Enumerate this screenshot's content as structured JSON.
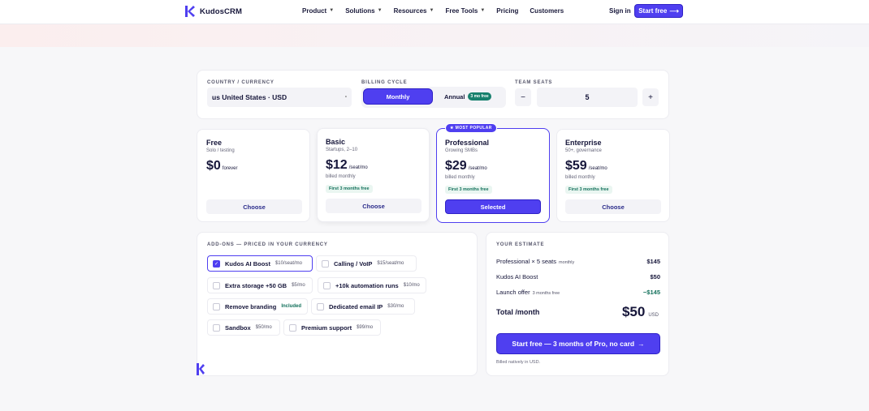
{
  "nav": {
    "brand": "KudosCRM",
    "links": [
      {
        "label": "Product",
        "dropdown": true
      },
      {
        "label": "Solutions",
        "dropdown": true
      },
      {
        "label": "Resources",
        "dropdown": true
      },
      {
        "label": "Free Tools",
        "dropdown": true
      },
      {
        "label": "Pricing",
        "dropdown": false
      },
      {
        "label": "Customers",
        "dropdown": false
      }
    ],
    "sign_in": "Sign in",
    "start_free": "Start free",
    "start_free_arrow": "⟶"
  },
  "config": {
    "country_label": "COUNTRY / CURRENCY",
    "country_value": "us United States · USD",
    "billing_label": "BILLING CYCLE",
    "billing_monthly": "Monthly",
    "billing_annual": "Annual",
    "billing_annual_badge": "3 mo free",
    "seats_label": "TEAM SEATS",
    "seats_value": "5",
    "seats_minus": "−",
    "seats_plus": "+"
  },
  "plans": [
    {
      "name": "Free",
      "sub": "Solo / testing",
      "price": "$0",
      "unit": "forever",
      "billed": "",
      "promo": "",
      "button": "Choose",
      "selected": false
    },
    {
      "name": "Basic",
      "sub": "Startups, 2–10",
      "price": "$12",
      "unit": "/seat/mo",
      "billed": "billed monthly",
      "promo": "First 3 months free",
      "button": "Choose",
      "selected": false
    },
    {
      "name": "Professional",
      "sub": "Growing SMBs",
      "price": "$29",
      "unit": "/seat/mo",
      "billed": "billed monthly",
      "promo": "First 3 months free",
      "button": "Selected",
      "selected": true,
      "badge": "★ MOST POPULAR"
    },
    {
      "name": "Enterprise",
      "sub": "50+, governance",
      "price": "$59",
      "unit": "/seat/mo",
      "billed": "billed monthly",
      "promo": "First 3 months free",
      "button": "Choose",
      "selected": false
    }
  ],
  "addons": {
    "title": "ADD-ONS — PRICED IN YOUR CURRENCY",
    "items": [
      {
        "name": "Kudos AI Boost",
        "price": "$10/seat/mo",
        "checked": true
      },
      {
        "name": "Calling / VoIP",
        "price": "$15/seat/mo",
        "checked": false
      },
      {
        "name": "Extra storage +50 GB",
        "price": "$5/mo",
        "checked": false
      },
      {
        "name": "+10k automation runs",
        "price": "$10/mo",
        "checked": false
      },
      {
        "name": "Remove branding",
        "price": "Included",
        "checked": false
      },
      {
        "name": "Dedicated email IP",
        "price": "$30/mo",
        "checked": false
      },
      {
        "name": "Sandbox",
        "price": "$50/mo",
        "checked": false
      },
      {
        "name": "Premium support",
        "price": "$99/mo",
        "checked": false
      }
    ]
  },
  "estimate": {
    "title": "YOUR ESTIMATE",
    "rows": [
      {
        "label": "Professional × 5 seats",
        "note": "monthly",
        "value": "$145"
      },
      {
        "label": "Kudos AI Boost",
        "note": "",
        "value": "$50"
      },
      {
        "label": "Launch offer",
        "note": "3 months free",
        "value": "−$145"
      }
    ],
    "total_label": "Total /month",
    "total_value": "$50",
    "total_currency": "USD",
    "cta": "Start free — 3 months of Pro, no card",
    "cta_arrow": "→",
    "note": "Billed natively in USD."
  },
  "colors": {
    "accent": "#4f3ff0",
    "success": "#116f5a",
    "text": "#16163a"
  }
}
